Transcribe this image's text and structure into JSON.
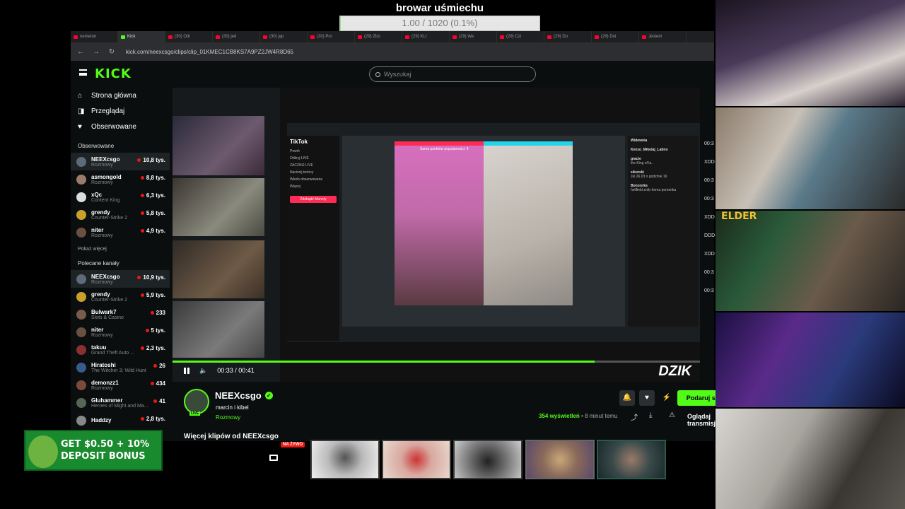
{
  "overlay": {
    "goal_title": "browar uśmiechu",
    "goal_text": "1.00 / 1020 (0.1%)",
    "goal_progress": 0.001
  },
  "browser": {
    "tabs": [
      "nemeton",
      "Kick",
      "(30) Odi",
      "(30) jed",
      "(30) jap",
      "(30) Pro",
      "(29) Zbo",
      "(29) KLI",
      "(29) We",
      "(29) Czi",
      "(29) Do",
      "(29) Doi",
      "Jestem"
    ],
    "active_tab": 1,
    "url": "kick.com/neexcsgo/clips/clip_01KMEC1CB8KS7A9PZ2JW4R8D65"
  },
  "kick": {
    "search_placeholder": "Wyszukaj",
    "nav": [
      {
        "label": "Strona główna",
        "icon": "home-icon",
        "glyph": "⌂"
      },
      {
        "label": "Przeglądaj",
        "icon": "browse-icon",
        "glyph": "◨"
      },
      {
        "label": "Obserwowane",
        "icon": "heart-icon",
        "glyph": "♥"
      }
    ],
    "followed_title": "Obserwowane",
    "followed": [
      {
        "name": "NEEXcsgo",
        "category": "Rozmowy",
        "viewers": "10,8 tys.",
        "color": "#5d6a78",
        "highlight": true
      },
      {
        "name": "asmongold",
        "category": "Rozmowy",
        "viewers": "8,8 tys.",
        "color": "#9b7c6a"
      },
      {
        "name": "xQc",
        "category": "Content King",
        "viewers": "6,3 tys.",
        "color": "#dddddd"
      },
      {
        "name": "grendy",
        "category": "Counter-Strike 2",
        "viewers": "5,8 tys.",
        "color": "#c9a02c"
      },
      {
        "name": "niter",
        "category": "Rozmowy",
        "viewers": "4,9 tys.",
        "color": "#6a5040"
      }
    ],
    "show_more": "Pokaż więcej",
    "recommended_title": "Polecane kanały",
    "recommended": [
      {
        "name": "NEEXcsgo",
        "category": "Rozmowy",
        "viewers": "10,9 tys.",
        "color": "#5d6a78",
        "highlight": true
      },
      {
        "name": "grendy",
        "category": "Counter-Strike 2",
        "viewers": "5,9 tys.",
        "color": "#c9a02c"
      },
      {
        "name": "Bulwark7",
        "category": "Slots & Casino",
        "viewers": "233",
        "color": "#7a5a4a"
      },
      {
        "name": "niter",
        "category": "Rozmowy",
        "viewers": "5 tys.",
        "color": "#6a5040"
      },
      {
        "name": "takuu",
        "category": "Grand Theft Auto ...",
        "viewers": "2,3 tys.",
        "color": "#8a3030"
      },
      {
        "name": "Hiratoshi",
        "category": "The Witcher 3: Wild Hunt",
        "viewers": "26",
        "color": "#3a5a8a"
      },
      {
        "name": "demonzz1",
        "category": "Rozmowy",
        "viewers": "434",
        "color": "#7a4a3a"
      },
      {
        "name": "Gluhammer",
        "category": "Heroes of Might and Ma...",
        "viewers": "41",
        "color": "#556655"
      },
      {
        "name": "Haddzy",
        "category": "",
        "viewers": "2,8 tys.",
        "color": "#888888"
      }
    ]
  },
  "player": {
    "time": "00:33 / 00:41",
    "progress": 0.8,
    "watermark": "DZIK",
    "inner": {
      "tiktok_title": "TikTok",
      "tiktok_items": [
        "Powiń",
        "Odkryj LIVE",
        "ZACZNIJ LIVE",
        "Nacisnij twórcy",
        "Wkolo obserwowane",
        "Więcej"
      ],
      "tiktok_button": "Zdobądź Monety",
      "battle_label": "Suma punktów popularności: 9",
      "chat": [
        {
          "user": "Widownia",
          "text": ""
        },
        {
          "user": "Kenzo_Mikolaj_Latino",
          "text": ""
        },
        {
          "user": "gracie",
          "text": "the King of la.."
        },
        {
          "user": "sikorski",
          "text": "Jul 26.03 o godzinie 16"
        },
        {
          "user": "Bonzonks",
          "text": "hellfield zrób forma ponomka"
        }
      ]
    }
  },
  "clip": {
    "streamer": "NEEXcsgo",
    "title": "marcin i kibel",
    "category": "Rozmowy",
    "live_badge": "LIVE",
    "subscribe_label": "Podaruj subskrypcje",
    "views": "354 wyświetleń",
    "ago": "• 8 minut temu",
    "watch_label": "Oglądaj transmisję",
    "more_clips": "Więcej klipów od NEEXcsgo"
  },
  "overlay_bottom": {
    "bonus_line1": "GET $0.50 + 10%",
    "bonus_line2": "DEPOSIT BONUS",
    "live_label": "NA ŻYWO",
    "elder_logo": "ELDER",
    "side_times": [
      "00:3",
      "XDD",
      "00:3",
      "00:3",
      "XDD",
      "DDD",
      "XDD",
      "00:3",
      "00:3"
    ]
  }
}
